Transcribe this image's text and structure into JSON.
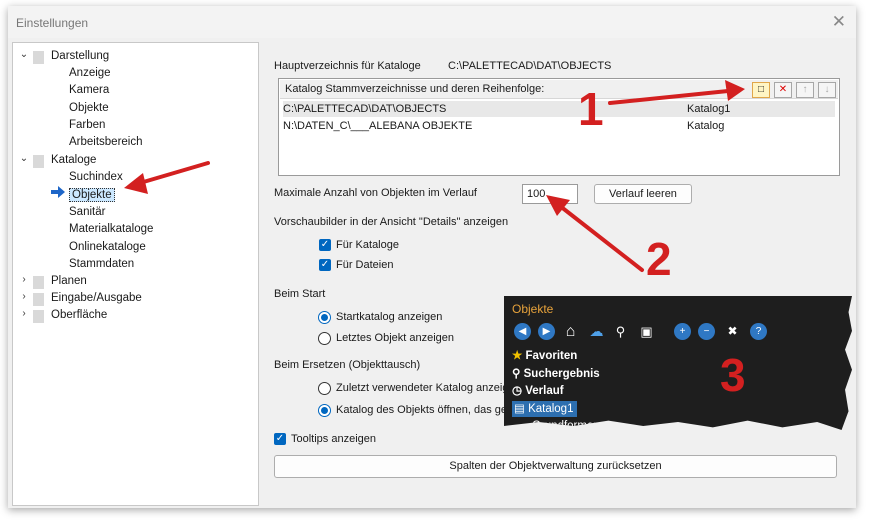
{
  "window": {
    "title": "Einstellungen",
    "close": "✕"
  },
  "tree": {
    "items": [
      {
        "label": "Darstellung",
        "level": 0,
        "expanded": true
      },
      {
        "label": "Anzeige",
        "level": 1
      },
      {
        "label": "Kamera",
        "level": 1
      },
      {
        "label": "Objekte",
        "level": 1
      },
      {
        "label": "Farben",
        "level": 1
      },
      {
        "label": "Arbeitsbereich",
        "level": 1
      },
      {
        "label": "Kataloge",
        "level": 0,
        "expanded": true
      },
      {
        "label": "Suchindex",
        "level": 1
      },
      {
        "label": "Objekte",
        "level": 1,
        "selected": true
      },
      {
        "label": "Sanitär",
        "level": 1
      },
      {
        "label": "Materialkataloge",
        "level": 1
      },
      {
        "label": "Onlinekataloge",
        "level": 1
      },
      {
        "label": "Stammdaten",
        "level": 1
      },
      {
        "label": "Planen",
        "level": 0,
        "expanded": false
      },
      {
        "label": "Eingabe/Ausgabe",
        "level": 0,
        "expanded": false
      },
      {
        "label": "Oberfläche",
        "level": 0,
        "expanded": false
      }
    ]
  },
  "settings": {
    "main_dir_label": "Hauptverzeichnis für Kataloge",
    "main_dir_value": "C:\\PALETTECAD\\DAT\\OBJECTS",
    "list_header": "Katalog Stammverzeichnisse und deren Reihenfolge:",
    "list_rows": [
      {
        "path": "C:\\PALETTECAD\\DAT\\OBJECTS",
        "name": "Katalog1"
      },
      {
        "path": "N:\\DATEN_C\\___ALEBANA OBJEKTE",
        "name": "Katalog"
      }
    ],
    "max_history_label": "Maximale Anzahl von Objekten im Verlauf",
    "max_history_value": "100",
    "clear_history_button": "Verlauf leeren",
    "preview_label": "Vorschaubilder in der Ansicht \"Details\" anzeigen",
    "cb_catalogs": "Für Kataloge",
    "cb_files": "Für Dateien",
    "start_label": "Beim Start",
    "rb_start_catalog": "Startkatalog anzeigen",
    "rb_last_object": "Letztes Objekt anzeigen",
    "replace_label": "Beim Ersetzen (Objekttausch)",
    "rb_last_catalog": "Zuletzt verwendeter Katalog anzeigen",
    "rb_open_catalog": "Katalog des Objekts öffnen, das getauscht wird",
    "tooltips": "Tooltips anzeigen",
    "reset_columns_button": "Spalten der Objektverwaltung zurücksetzen"
  },
  "annotations": {
    "n1": "1",
    "n2": "2",
    "n3": "3",
    "arrow_color": "#d32020"
  },
  "overlay": {
    "title": "Objekte",
    "items": [
      "Favoriten",
      "Suchergebnis",
      "Verlauf",
      "Katalog1",
      "Grundformen"
    ]
  }
}
